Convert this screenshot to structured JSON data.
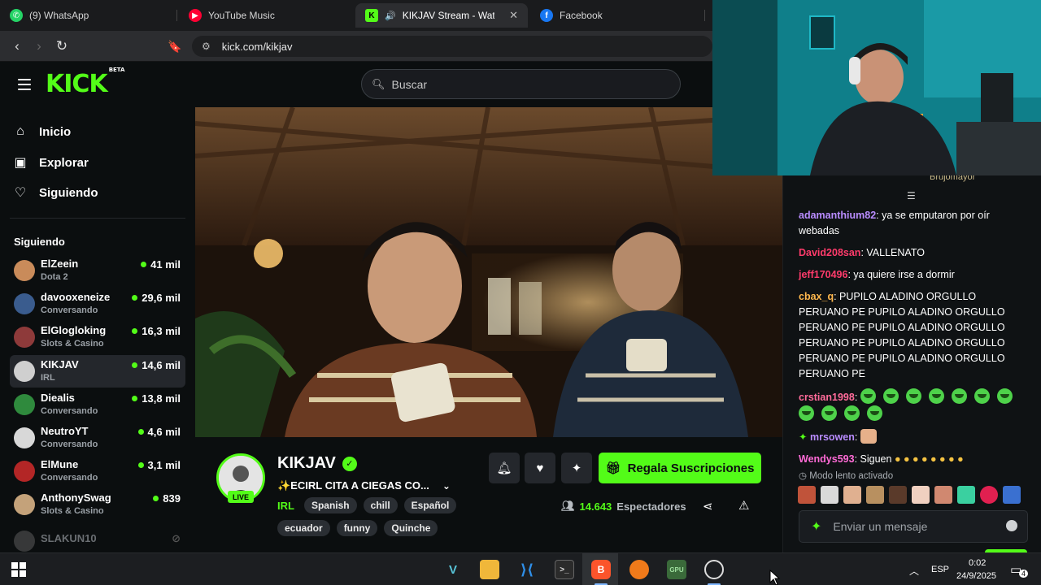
{
  "browser": {
    "tabs": [
      {
        "label": "(9) WhatsApp",
        "icon": "whatsapp-icon",
        "color": "#25d366"
      },
      {
        "label": "YouTube Music",
        "icon": "youtube-music-icon",
        "color": "#ff0033"
      },
      {
        "label": "KIKJAV Stream - Watch Liv",
        "icon": "kick-icon",
        "color": "#53fc18"
      },
      {
        "label": "Facebook",
        "icon": "facebook-icon",
        "color": "#1877f2"
      }
    ],
    "url": "kick.com/kikjav"
  },
  "header": {
    "logo": "KICK",
    "logo_badge": "BETA",
    "search_placeholder": "Buscar"
  },
  "sidebar": {
    "nav": [
      {
        "label": "Inicio",
        "icon": "home-icon"
      },
      {
        "label": "Explorar",
        "icon": "explore-icon"
      },
      {
        "label": "Siguiendo",
        "icon": "heart-icon"
      }
    ],
    "section_title": "Siguiendo",
    "channels": [
      {
        "name": "ElZeein",
        "category": "Dota 2",
        "viewers": "41 mil",
        "color": "#c98b5a"
      },
      {
        "name": "davooxeneize",
        "category": "Conversando",
        "viewers": "29,6 mil",
        "color": "#3a5c8e"
      },
      {
        "name": "ElGlogloking",
        "category": "Slots & Casino",
        "viewers": "16,3 mil",
        "color": "#8e3a3a"
      },
      {
        "name": "KIKJAV",
        "category": "IRL",
        "viewers": "14,6 mil",
        "color": "#cfcfcf"
      },
      {
        "name": "Diealis",
        "category": "Conversando",
        "viewers": "13,8 mil",
        "color": "#2f8a3d"
      },
      {
        "name": "NeutroYT",
        "category": "Conversando",
        "viewers": "4,6 mil",
        "color": "#d8d8d8"
      },
      {
        "name": "ElMune",
        "category": "Conversando",
        "viewers": "3,1 mil",
        "color": "#b32626"
      },
      {
        "name": "AnthonySwag",
        "category": "Slots & Casino",
        "viewers": "839",
        "color": "#c4a27a"
      },
      {
        "name": "SLAKUN10",
        "category": "",
        "viewers": "",
        "color": "#555"
      }
    ]
  },
  "stream": {
    "channel": "KIKJAV",
    "live_label": "LIVE",
    "title": "✨ECIRL CITA A CIEGAS CO...",
    "category": "IRL",
    "tags_row1": [
      "Spanish",
      "chill",
      "Español"
    ],
    "tags_row2": [
      "ecuador",
      "funny",
      "Quinche"
    ],
    "gift_label": "Regala Suscripciones",
    "viewers_count": "14.643",
    "viewers_label": "Espectadores"
  },
  "chat": {
    "peek": "Brujomayor",
    "messages": [
      {
        "user": "adamanthium82",
        "color": "#b98cff",
        "text": "ya se emputaron por oír webadas"
      },
      {
        "user": "David208san",
        "color": "#ff3b6b",
        "text": "VALLENATO"
      },
      {
        "user": "jeff170496",
        "color": "#ff3b6b",
        "text": "ya quiere irse a dormir"
      },
      {
        "user": "cbax_q",
        "color": "#ffb84d",
        "text": "PUPILO ALADINO ORGULLO PERUANO PE PUPILO ALADINO ORGULLO PERUANO PE PUPILO ALADINO ORGULLO PERUANO PE PUPILO ALADINO ORGULLO PERUANO PE PUPILO ALADINO ORGULLO PERUANO PE"
      },
      {
        "user": "crstian1998",
        "color": "#ff6b9a",
        "text": ""
      },
      {
        "user": "mrsowen",
        "color": "#b98cff",
        "text": ""
      },
      {
        "user": "Wendys593",
        "color": "#ff6bd6",
        "text": "Siguen"
      }
    ],
    "slow_mode": "Modo lento activado",
    "input_placeholder": "Enviar un mensaje"
  },
  "taskbar": {
    "lang": "ESP",
    "time": "0:02",
    "date": "24/9/2025",
    "notifications": "4"
  }
}
